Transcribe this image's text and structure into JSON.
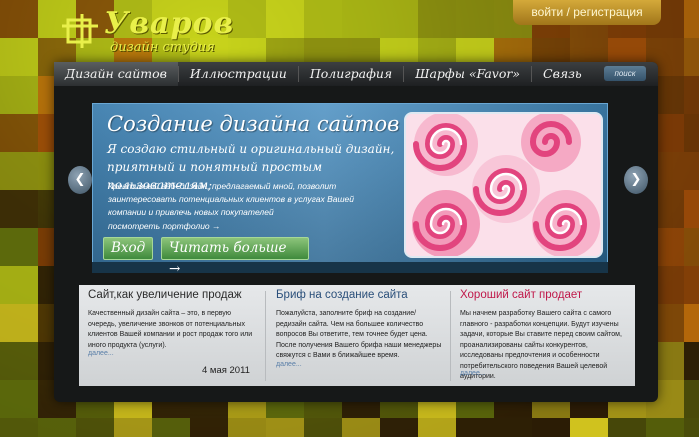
{
  "header": {
    "logo_name": "Уваров",
    "logo_subtitle": "дизайн студия",
    "login_label": "войти / регистрация"
  },
  "nav": {
    "items": [
      "Дизайн сайтов",
      "Иллюстрации",
      "Полиграфия",
      "Шарфы «Favor»",
      "Связь"
    ],
    "search_label": "поиск"
  },
  "hero": {
    "title": "Создание дизайна сайтов",
    "lead": "Я создаю стильный и оригинальный дизайн, приятный и понятный простым пользователям;",
    "text": "Креативный веб–дизайн, предлагаемый мной, позволит заинтересовать потенциальных клиентов в услугах Вашей компании и привлечь новых покупателей",
    "portfolio_link": "посмотреть портфолио →",
    "login_button": "Вход",
    "more_button": "Читать больше →"
  },
  "columns": [
    {
      "title": "Сайт,как увеличение продаж",
      "title_color": "#2b2b2b",
      "body": "Качественный дизайн сайта – это, в первую очередь, увеличение звонков от потенциальных клиентов Вашей компании и рост продаж того или иного продукта (услуги).",
      "more": "далее...",
      "date": "4 мая 2011"
    },
    {
      "title": "Бриф на создание сайта",
      "title_color": "#2a4f7a",
      "body": "Пожалуйста, заполните бриф на создание/редизайн сайта. Чем на большее количество вопросов Вы ответите, тем точнее будет цена. После получения Вашего брифа наши менеджеры свяжутся с Вами в ближайшее время.",
      "more": "далее...",
      "date": ""
    },
    {
      "title": "Хороший сайт продает",
      "title_color": "#c0184a",
      "body": "Мы начнем разработку Вашего сайта с самого главного - разработки концепции. Будут изучены задачи, которые Вы ставите перед своим сайтом, проанализированы сайты конкурентов, исследованы предпочтения и особенности потребительского поведения Вашей целевой аудитории.",
      "more": "далее...",
      "date": ""
    }
  ],
  "colors": {
    "accent_yellow": "#e9f04a",
    "button_green": "#4f9a46",
    "hero_blue": "#4a8cbc",
    "headline_red": "#c0184a"
  },
  "icons": {
    "logo": "logo-mark-icon",
    "prev": "chevron-left-icon",
    "next": "chevron-right-icon"
  }
}
